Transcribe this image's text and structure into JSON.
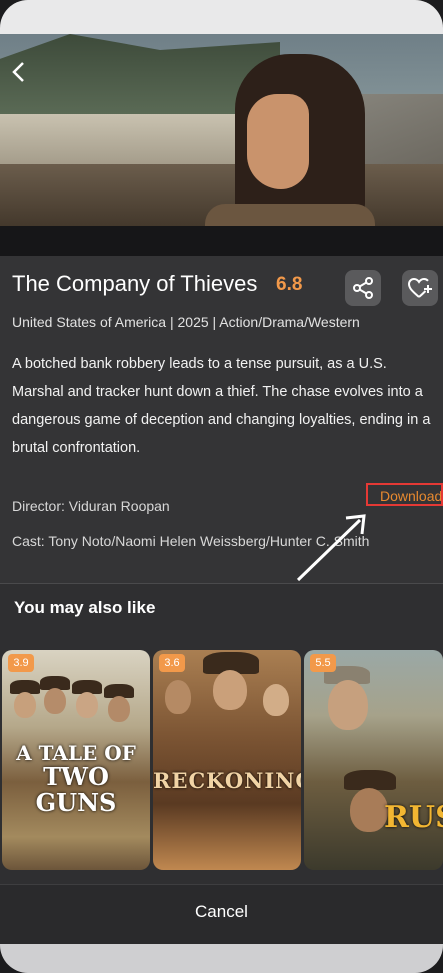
{
  "hero": {
    "back_icon": "chevron-left-icon"
  },
  "movie": {
    "title": "The Company of Thieves",
    "rating": "6.8",
    "meta": "United States of America | 2025 | Action/Drama/Western",
    "description": "A botched bank robbery leads to a tense pursuit, as a U.S. Marshal and tracker hunt down a thief. The chase evolves into a dangerous game of deception and changing loyalties, ending in a brutal confrontation.",
    "download_label": "Download",
    "director": "Director: Viduran Roopan",
    "cast": "Cast: Tony Noto/Naomi Helen Weissberg/Hunter C. Smith",
    "share_icon": "share-icon",
    "favorite_icon": "heart-plus-icon"
  },
  "similar": {
    "title": "You may also like",
    "items": [
      {
        "rating": "3.9",
        "poster_text_1": "A TALE OF",
        "poster_text_2": "TWO GUNS"
      },
      {
        "rating": "3.6",
        "poster_text_1": "RECKONING"
      },
      {
        "rating": "5.5",
        "poster_text_1": "RUST"
      }
    ]
  },
  "footer": {
    "cancel_label": "Cancel"
  },
  "colors": {
    "accent": "#f2994a",
    "highlight_box": "#e53935",
    "background": "#343436"
  }
}
